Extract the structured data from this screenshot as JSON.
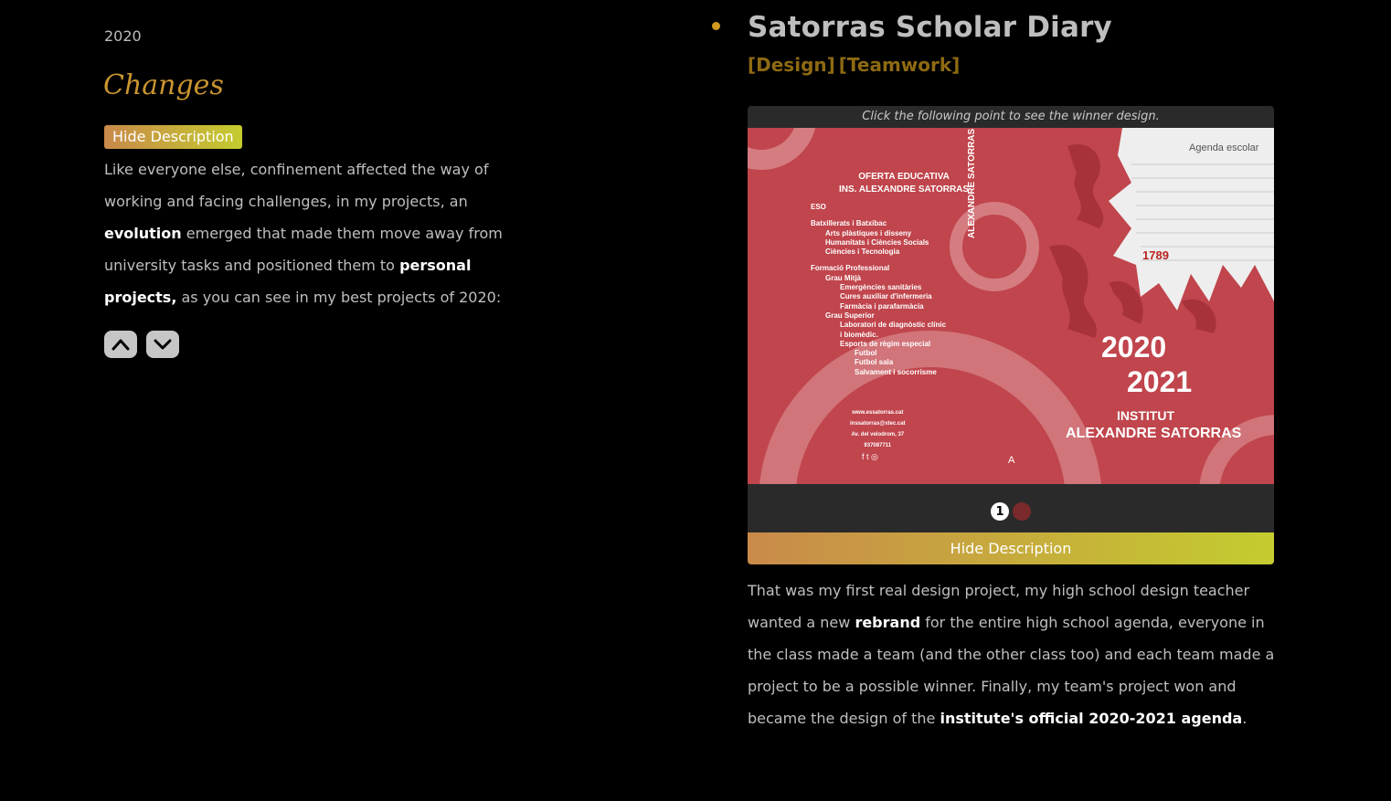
{
  "left": {
    "year": "2020",
    "section_title": "Changes",
    "hide_label": "Hide Description",
    "desc": {
      "p1": "Like everyone else, confinement affected the way of working and facing challenges, in my projects, an ",
      "b1": "evolution",
      "p2": " emerged that made them move away from university tasks and positioned them to ",
      "b2": "personal projects,",
      "p3": " as you can see in my best projects of 2020:"
    },
    "nav": {
      "up_icon": "chevron-up-icon",
      "down_icon": "chevron-down-icon"
    }
  },
  "project": {
    "title": "Satorras Scholar Diary",
    "tags": [
      "[Design]",
      "[Teamwork]"
    ],
    "gallery": {
      "caption": "Click the following point to see the winner design.",
      "slides": [
        "1",
        ""
      ],
      "active_slide": 1,
      "hide_label": "Hide Description"
    },
    "cover": {
      "top_right": "Agenda escolar",
      "heading1": "OFERTA EDUCATIVA",
      "heading2": "INS. ALEXANDRE SATORRAS",
      "items": [
        "ESO",
        "Batxillerats i Batxibac",
        "Arts plàstiques i disseny",
        "Humanitats i Ciències Socials",
        "Ciències i Tecnologia",
        "Formació Professional",
        "Grau Mitjà",
        "Emergències sanitàries",
        "Cures auxiliar d'infermeria",
        "Farmàcia i parafarmàcia",
        "Grau Superior",
        "Laboratori de diagnòstic clínic",
        "i biomèdic.",
        "Esports de règim especial",
        "Futbol",
        "Futbol sala",
        "Salvament i socorrisme"
      ],
      "spine": "ALEXANDRE SATORRAS",
      "contact": [
        "www.essatorras.cat",
        "inssatorras@xtec.cat",
        "Av. del velodrom, 37",
        "937087711"
      ],
      "year1": "2020",
      "year2": "2021",
      "institut": "INSTITUT",
      "name": "ALEXANDRE SATORRAS",
      "letter": "A",
      "founded": "1789",
      "colors": {
        "red": "#c0454c",
        "light": "#d98a8f"
      }
    },
    "desc": {
      "p1": "That was my first real design project, my high school design teacher wanted a new ",
      "b1": "rebrand",
      "p2": " for the entire high school agenda, everyone in the class made a team (and the other class too) and each team made a project to be a possible winner. Finally, my team's project won and became the design of the ",
      "b2": "institute's official 2020-2021 agenda",
      "p3": "."
    }
  },
  "colors": {
    "accent": "#c9952f",
    "tag": "#8e6a12",
    "bullet": "#d29a1f"
  }
}
